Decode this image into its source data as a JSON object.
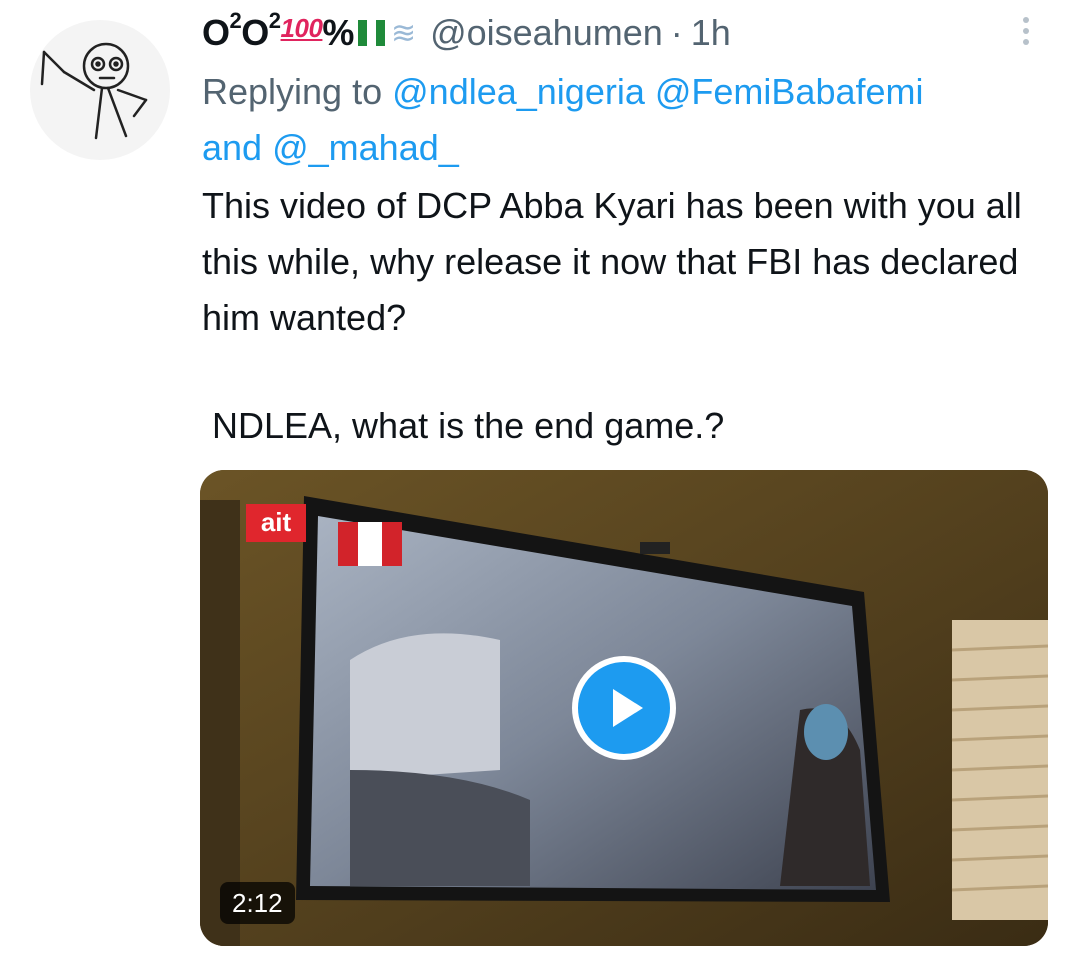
{
  "tweet": {
    "display_name_prefix": "O",
    "display_name_sup1": "2",
    "display_name_mid": "O",
    "display_name_sup2": "2",
    "display_name_hundred": "100",
    "display_name_suffix": "%",
    "handle": "@oiseahumen",
    "separator": "·",
    "time": "1h",
    "replying_to_label": "Replying to",
    "mentions": [
      "@ndlea_nigeria",
      "@FemiBabafemi",
      "@_mahad_"
    ],
    "mention_joiner": "and",
    "body_paragraph_1": "This video of DCP Abba Kyari has been with you all this while, why release it now that FBI has declared him wanted?",
    "body_paragraph_2": "NDLEA, what is the end game.?"
  },
  "media": {
    "type": "video",
    "duration": "2:12",
    "channel_logo": "ait",
    "play_icon": "play-icon"
  },
  "icons": {
    "more": "more-vertical-icon",
    "flag": "nigeria-flag-icon",
    "dash": "dash-emoji-icon"
  },
  "colors": {
    "mention": "#1d9bf0",
    "secondary_text": "#536471",
    "play_button": "#1d9bf0",
    "channel_logo": "#e0262d"
  }
}
